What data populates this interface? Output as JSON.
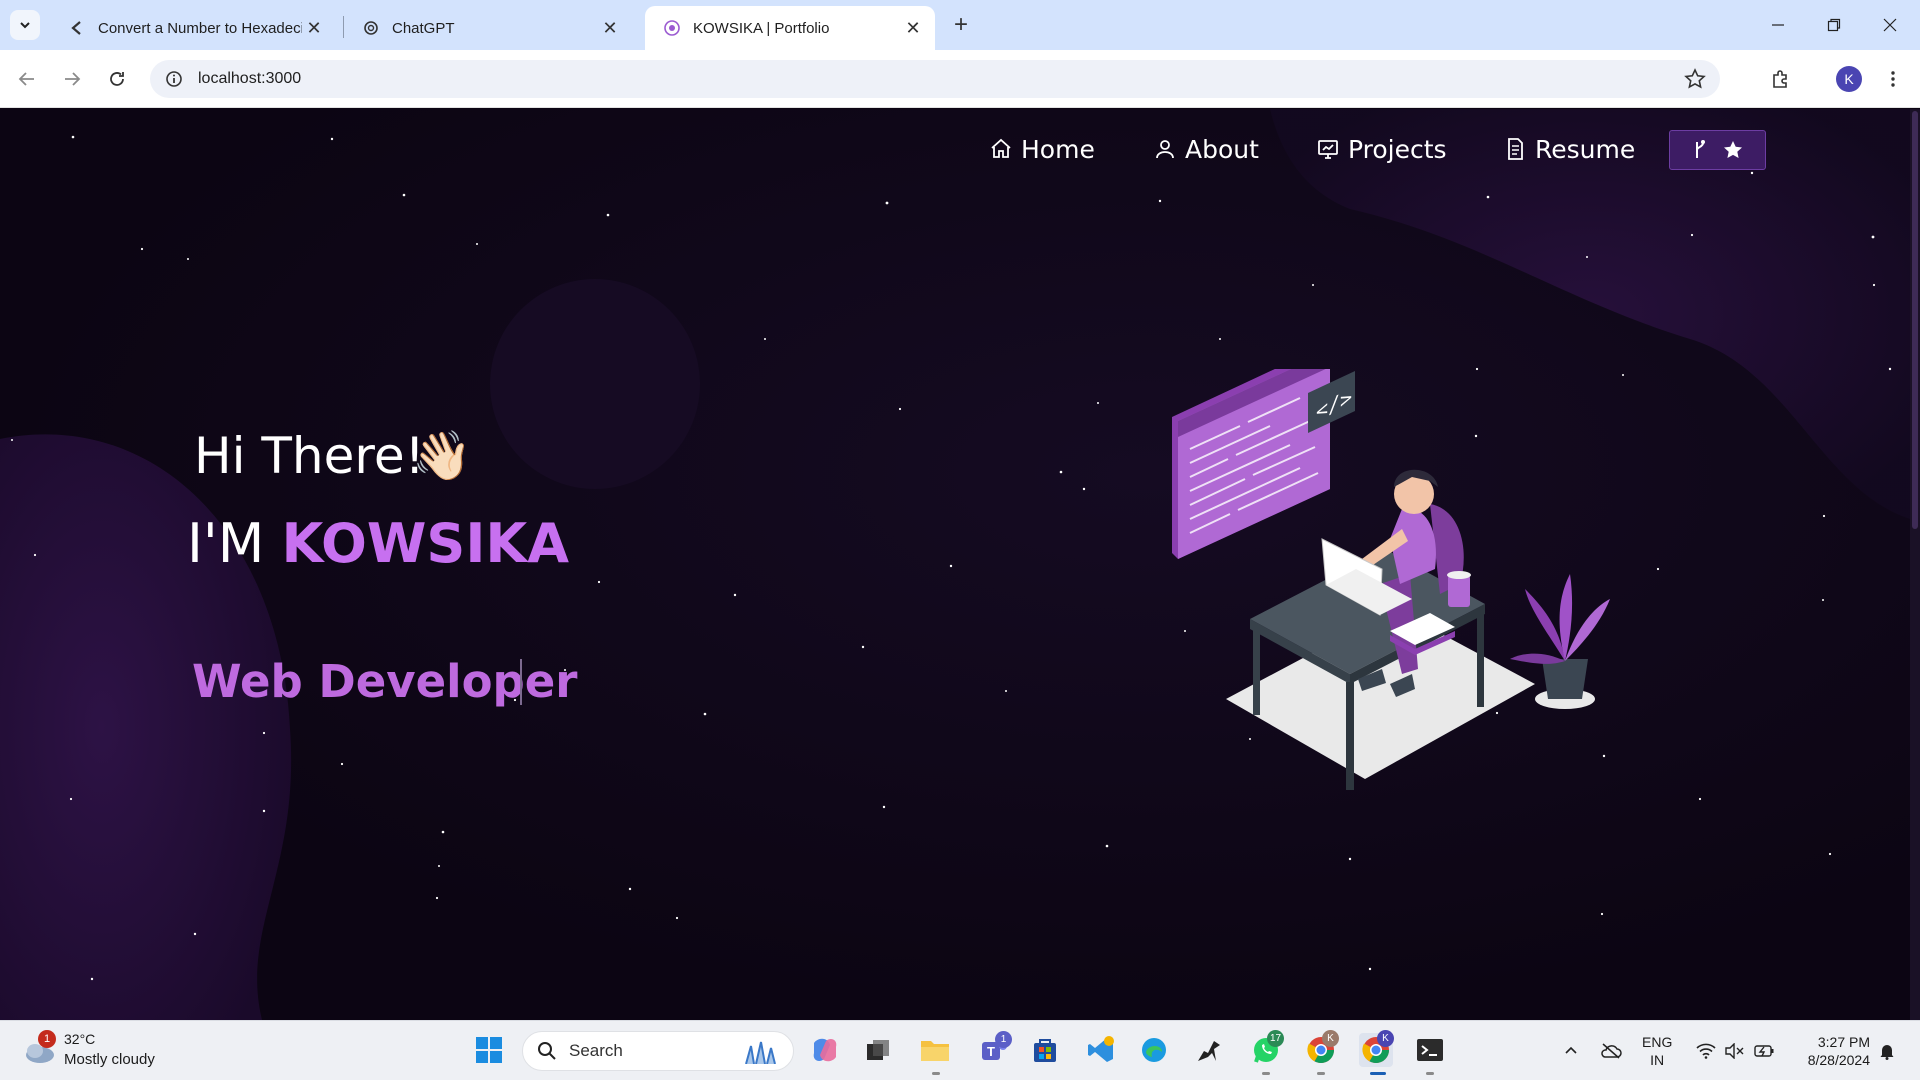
{
  "browser": {
    "tabs": [
      {
        "title": "Convert a Number to Hexadeci",
        "active": false
      },
      {
        "title": "ChatGPT",
        "active": false
      },
      {
        "title": "KOWSIKA | Portfolio",
        "active": true
      }
    ],
    "url": "localhost:3000",
    "profile_initial": "K"
  },
  "nav": {
    "items": [
      {
        "label": "Home",
        "icon": "home-icon"
      },
      {
        "label": "About",
        "icon": "user-icon"
      },
      {
        "label": "Projects",
        "icon": "projects-icon"
      },
      {
        "label": "Resume",
        "icon": "document-icon"
      }
    ],
    "fork_icons": [
      "fork-icon",
      "star-icon"
    ]
  },
  "hero": {
    "greeting": "Hi There!",
    "greeting_emoji": "👋🏻",
    "im_prefix": "I'M",
    "name": "KOWSIKA",
    "role": "Web Developer"
  },
  "taskbar": {
    "weather": {
      "temp": "32°C",
      "desc": "Mostly cloudy",
      "badge": "1"
    },
    "search_placeholder": "Search",
    "teams_badge": "1",
    "whatsapp_badge": "17",
    "profile_badge": "K",
    "language": [
      "ENG",
      "IN"
    ],
    "time": "3:27 PM",
    "date": "8/28/2024"
  },
  "colors": {
    "accent": "#c770f0",
    "page_bg": "#0c0513",
    "blob": "#2a1140"
  }
}
